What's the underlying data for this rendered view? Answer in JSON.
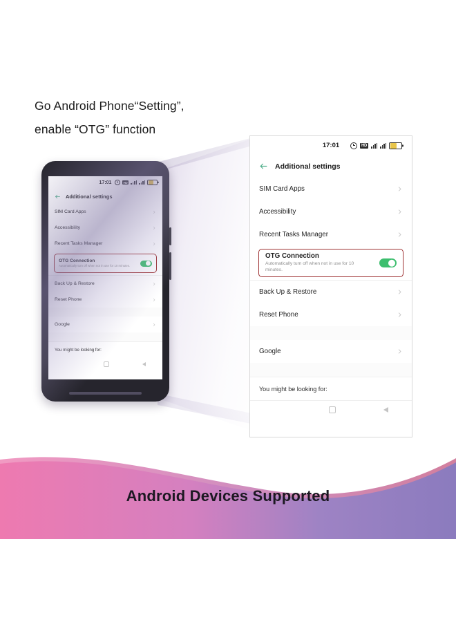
{
  "headline": {
    "line1": "Go Android Phone“Setting”,",
    "line2": "enable “OTG” function"
  },
  "phone_screen": {
    "statusbar": {
      "time": "17:01",
      "icons": [
        "alarm-icon",
        "hd-call-icon",
        "signal-1-icon",
        "signal-2-icon",
        "battery-icon"
      ],
      "hd_label": "HD"
    },
    "appbar": {
      "back_icon": "back-arrow-icon",
      "title": "Additional settings",
      "back_color": "#4fae8b"
    },
    "rows_top": [
      {
        "label": "SIM Card Apps"
      },
      {
        "label": "Accessibility"
      },
      {
        "label": "Recent Tasks Manager"
      }
    ],
    "otg": {
      "title": "OTG Connection",
      "subtitle": "Automatically turn off when not in use for 10 minutes.",
      "toggle_state": "on",
      "toggle_color": "#3dbe6e",
      "highlight_color": "#9d2f30"
    },
    "rows_mid": [
      {
        "label": "Back Up & Restore"
      },
      {
        "label": "Reset Phone"
      }
    ],
    "rows_bottom": [
      {
        "label": "Google"
      }
    ],
    "footer": {
      "label": "You might be looking for:"
    },
    "navbar": {
      "items": [
        "recents-icon",
        "home-icon",
        "back-icon"
      ]
    }
  },
  "banner": {
    "title": "Android Devices Supported",
    "color_left": "#ee7ab0",
    "color_right": "#8b7bbe",
    "text_color": "#1c1822"
  }
}
